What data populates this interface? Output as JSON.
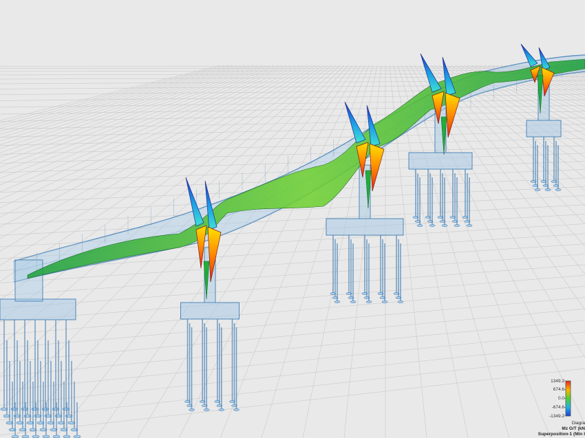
{
  "viewport": {
    "description_name": "3d-model-viewport"
  },
  "colors": {
    "background": "#e9e9e9",
    "grid": "#c9c9c9",
    "structure_fill": "#a9cbe6",
    "structure_stroke": "#4f86b8",
    "diagram_positive": "#e83a1e",
    "diagram_zero": "#1fae3a",
    "diagram_negative": "#1a4fd8"
  },
  "legend": {
    "scale": [
      "1349.2",
      "674.6",
      "0.0",
      "-674.6",
      "-1349.2"
    ],
    "title_line1": "Diagra",
    "title_line2": "Mz G/T (kN",
    "title_line3": "Superposition-1 (Min I"
  }
}
